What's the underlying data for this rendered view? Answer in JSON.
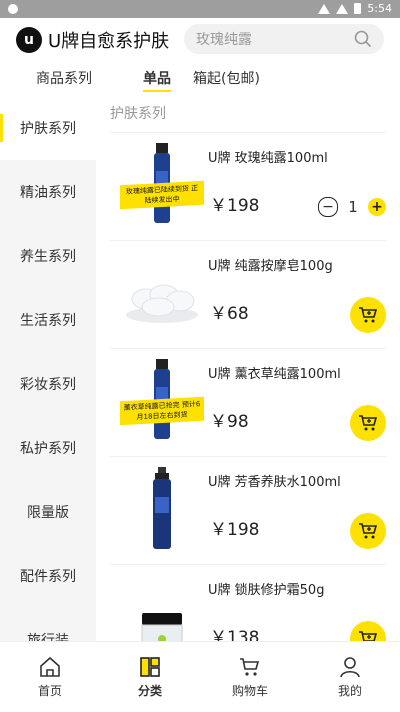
{
  "status": {
    "time": "5:54"
  },
  "header": {
    "brand": "U牌自愈系护肤",
    "logo_letter": "u",
    "search_placeholder": "玫瑰纯露"
  },
  "tabs": [
    {
      "label": "商品系列"
    },
    {
      "label": "单品",
      "active": true
    },
    {
      "label": "箱起(包邮)"
    }
  ],
  "sidebar": [
    {
      "label": "护肤系列",
      "active": true
    },
    {
      "label": "精油系列"
    },
    {
      "label": "养生系列"
    },
    {
      "label": "生活系列"
    },
    {
      "label": "彩妆系列"
    },
    {
      "label": "私护系列"
    },
    {
      "label": "限量版"
    },
    {
      "label": "配件系列"
    },
    {
      "label": "旅行装"
    }
  ],
  "section_title": "护肤系列",
  "products": [
    {
      "name": "U牌 玫瑰纯露100ml",
      "price": "￥198",
      "badge": "玫瑰纯露已陆续到货 正陆续发出中",
      "qty": "1",
      "image": "blue-bottle-icon"
    },
    {
      "name": "U牌 纯露按摩皂100g",
      "price": "￥68",
      "image": "soap-icon"
    },
    {
      "name": "U牌 薰衣草纯露100ml",
      "price": "￥98",
      "badge": "薰衣草纯露已抢完 预计6月18日左右到货",
      "image": "blue-bottle-icon"
    },
    {
      "name": "U牌 芳香养肤水100ml",
      "price": "￥198",
      "image": "blue-bottle-icon"
    },
    {
      "name": "U牌 锁肤修护霜50g",
      "price": "￥138",
      "image": "cream-jar-icon"
    }
  ],
  "bottomnav": [
    {
      "label": "首页",
      "icon": "home-icon"
    },
    {
      "label": "分类",
      "icon": "category-icon",
      "active": true
    },
    {
      "label": "购物车",
      "icon": "cart-icon"
    },
    {
      "label": "我的",
      "icon": "user-icon"
    }
  ],
  "colors": {
    "accent": "#ffe100",
    "statusbar": "#9e9e9e"
  }
}
